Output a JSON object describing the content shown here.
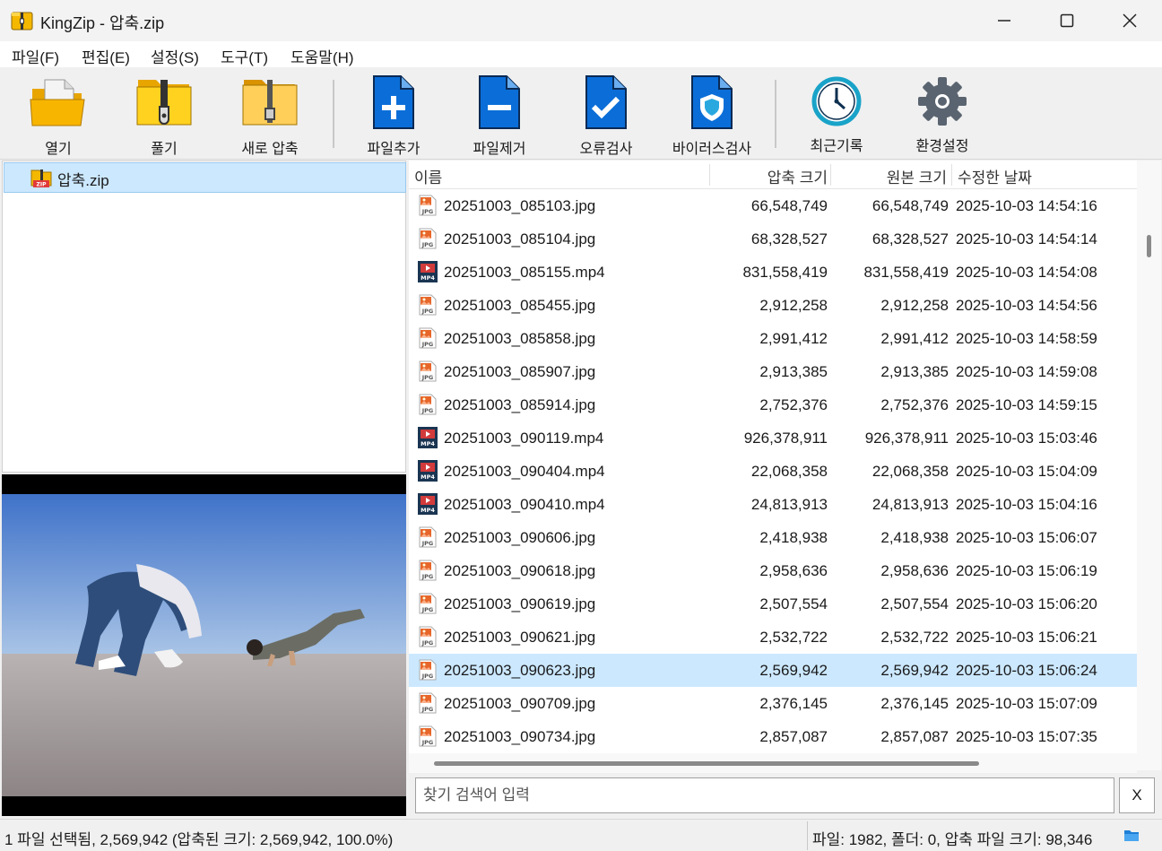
{
  "window": {
    "title": "KingZip - 압축.zip",
    "minimize_icon": "minimize-icon",
    "maximize_icon": "maximize-icon",
    "close_icon": "close-icon"
  },
  "menu": [
    {
      "label": "파일(F)"
    },
    {
      "label": "편집(E)"
    },
    {
      "label": "설정(S)"
    },
    {
      "label": "도구(T)"
    },
    {
      "label": "도움말(H)"
    }
  ],
  "toolbar": {
    "open": "열기",
    "extract": "풀기",
    "new_archive": "새로 압축",
    "add_file": "파일추가",
    "remove_file": "파일제거",
    "test": "오류검사",
    "virus_scan": "바이러스검사",
    "recent": "최근기록",
    "settings": "환경설정"
  },
  "tree": {
    "root_label": "압축.zip"
  },
  "list": {
    "columns": {
      "name": "이름",
      "compressed": "압축 크기",
      "original": "원본 크기",
      "modified": "수정한 날짜"
    },
    "selected_index": 14,
    "rows": [
      {
        "name": "20251003_085103.jpg",
        "type": "jpg",
        "compressed": "66,548,749",
        "original": "66,548,749",
        "modified": "2025-10-03 14:54:16"
      },
      {
        "name": "20251003_085104.jpg",
        "type": "jpg",
        "compressed": "68,328,527",
        "original": "68,328,527",
        "modified": "2025-10-03 14:54:14"
      },
      {
        "name": "20251003_085155.mp4",
        "type": "mp4",
        "compressed": "831,558,419",
        "original": "831,558,419",
        "modified": "2025-10-03 14:54:08"
      },
      {
        "name": "20251003_085455.jpg",
        "type": "jpg",
        "compressed": "2,912,258",
        "original": "2,912,258",
        "modified": "2025-10-03 14:54:56"
      },
      {
        "name": "20251003_085858.jpg",
        "type": "jpg",
        "compressed": "2,991,412",
        "original": "2,991,412",
        "modified": "2025-10-03 14:58:59"
      },
      {
        "name": "20251003_085907.jpg",
        "type": "jpg",
        "compressed": "2,913,385",
        "original": "2,913,385",
        "modified": "2025-10-03 14:59:08"
      },
      {
        "name": "20251003_085914.jpg",
        "type": "jpg",
        "compressed": "2,752,376",
        "original": "2,752,376",
        "modified": "2025-10-03 14:59:15"
      },
      {
        "name": "20251003_090119.mp4",
        "type": "mp4",
        "compressed": "926,378,911",
        "original": "926,378,911",
        "modified": "2025-10-03 15:03:46"
      },
      {
        "name": "20251003_090404.mp4",
        "type": "mp4",
        "compressed": "22,068,358",
        "original": "22,068,358",
        "modified": "2025-10-03 15:04:09"
      },
      {
        "name": "20251003_090410.mp4",
        "type": "mp4",
        "compressed": "24,813,913",
        "original": "24,813,913",
        "modified": "2025-10-03 15:04:16"
      },
      {
        "name": "20251003_090606.jpg",
        "type": "jpg",
        "compressed": "2,418,938",
        "original": "2,418,938",
        "modified": "2025-10-03 15:06:07"
      },
      {
        "name": "20251003_090618.jpg",
        "type": "jpg",
        "compressed": "2,958,636",
        "original": "2,958,636",
        "modified": "2025-10-03 15:06:19"
      },
      {
        "name": "20251003_090619.jpg",
        "type": "jpg",
        "compressed": "2,507,554",
        "original": "2,507,554",
        "modified": "2025-10-03 15:06:20"
      },
      {
        "name": "20251003_090621.jpg",
        "type": "jpg",
        "compressed": "2,532,722",
        "original": "2,532,722",
        "modified": "2025-10-03 15:06:21"
      },
      {
        "name": "20251003_090623.jpg",
        "type": "jpg",
        "compressed": "2,569,942",
        "original": "2,569,942",
        "modified": "2025-10-03 15:06:24"
      },
      {
        "name": "20251003_090709.jpg",
        "type": "jpg",
        "compressed": "2,376,145",
        "original": "2,376,145",
        "modified": "2025-10-03 15:07:09"
      },
      {
        "name": "20251003_090734.jpg",
        "type": "jpg",
        "compressed": "2,857,087",
        "original": "2,857,087",
        "modified": "2025-10-03 15:07:35"
      }
    ]
  },
  "search": {
    "placeholder": "찾기 검색어 입력",
    "value": "",
    "clear_label": "X"
  },
  "status": {
    "left": "1 파일 선택됨, 2,569,942 (압축된 크기: 2,569,942, 100.0%)",
    "right": "파일: 1982, 폴더: 0, 압축 파일 크기: 98,346"
  },
  "colors": {
    "selection": "#cce8ff",
    "folder_yellow": "#f5b800",
    "doc_blue": "#0b6ed8",
    "clock_teal": "#1aa3c8",
    "gear_gray": "#5a6470"
  }
}
